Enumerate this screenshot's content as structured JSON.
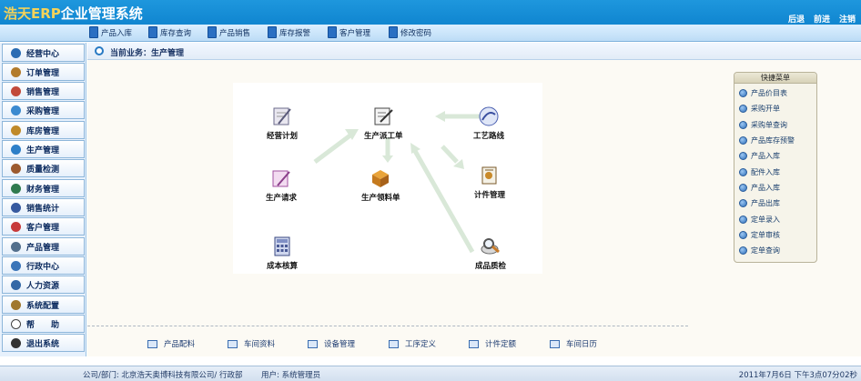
{
  "app": {
    "title_part1": "浩天ERP",
    "title_part2": "企业管理系统"
  },
  "header_nav": [
    "后退",
    "前进",
    "注销"
  ],
  "toolbar": [
    {
      "label": "产品入库",
      "icon": "document-icon"
    },
    {
      "label": "库存查询",
      "icon": "search-icon"
    },
    {
      "label": "产品销售",
      "icon": "cart-icon"
    },
    {
      "label": "库存报警",
      "icon": "alarm-icon"
    },
    {
      "label": "客户管理",
      "icon": "users-icon"
    },
    {
      "label": "修改密码",
      "icon": "key-icon"
    }
  ],
  "sidebar": {
    "items": [
      {
        "label": "经营中心",
        "icon": "globe-icon",
        "color": "#2b6cb3"
      },
      {
        "label": "订单管理",
        "icon": "order-icon",
        "color": "#b27b2b"
      },
      {
        "label": "销售管理",
        "icon": "chart-icon",
        "color": "#c24a3a"
      },
      {
        "label": "采购管理",
        "icon": "people-icon",
        "color": "#3b8ad0"
      },
      {
        "label": "库房管理",
        "icon": "warehouse-icon",
        "color": "#c08a2a"
      },
      {
        "label": "生产管理",
        "icon": "factory-icon",
        "color": "#2d7fc8"
      },
      {
        "label": "质量检测",
        "icon": "tools-icon",
        "color": "#9c5a2f"
      },
      {
        "label": "财务管理",
        "icon": "finance-icon",
        "color": "#2f7a4f"
      },
      {
        "label": "销售统计",
        "icon": "stats-icon",
        "color": "#375a9f"
      },
      {
        "label": "客户管理",
        "icon": "customers-icon",
        "color": "#c73a3a"
      },
      {
        "label": "产品管理",
        "icon": "product-icon",
        "color": "#536f8c"
      },
      {
        "label": "行政中心",
        "icon": "admin-icon",
        "color": "#3a74b8"
      },
      {
        "label": "人力资源",
        "icon": "hr-icon",
        "color": "#3468a6"
      },
      {
        "label": "系统配置",
        "icon": "config-icon",
        "color": "#a0782f"
      },
      {
        "label": "帮　　助",
        "icon": "help-icon",
        "color": "#444444"
      },
      {
        "label": "退出系统",
        "icon": "exit-icon",
        "color": "#333333"
      }
    ]
  },
  "breadcrumb": "当前业务：生产管理",
  "flow": {
    "nodes": [
      {
        "label": "经营计划",
        "icon": "plan-icon"
      },
      {
        "label": "生产派工单",
        "icon": "dispatch-icon"
      },
      {
        "label": "工艺路线",
        "icon": "process-icon"
      },
      {
        "label": "生产请求",
        "icon": "request-icon"
      },
      {
        "label": "生产领料单",
        "icon": "material-icon"
      },
      {
        "label": "计件管理",
        "icon": "piecework-icon"
      },
      {
        "label": "成本核算",
        "icon": "cost-icon"
      },
      {
        "label": "成品质检",
        "icon": "inspect-icon"
      }
    ]
  },
  "quick_menu": {
    "title": "快捷菜单",
    "items": [
      "产品价目表",
      "采购开单",
      "采购单查询",
      "产品库存预警",
      "产品入库",
      "配件入库",
      "产品入库",
      "产品出库",
      "定单录入",
      "定单审核",
      "定单查询"
    ]
  },
  "bottom_links": [
    "产品配料",
    "车间资料",
    "设备管理",
    "工序定义",
    "计件定额",
    "车间日历"
  ],
  "status": {
    "company": "公司/部门:   北京浩天奥博科技有限公司/ 行政部",
    "user": "用户:   系统管理员",
    "datetime": "2011年7月6日   下午3点07分02秒"
  }
}
